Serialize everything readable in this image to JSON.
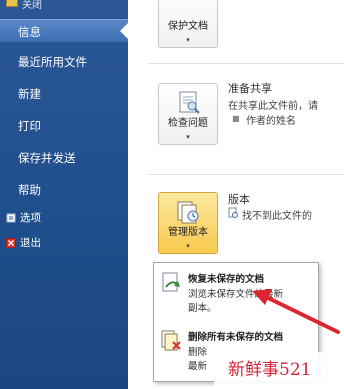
{
  "nav": {
    "partial_top": "关闭",
    "items": [
      {
        "label": "信息",
        "active": true
      },
      {
        "label": "最近所用文件"
      },
      {
        "label": "新建"
      },
      {
        "label": "打印"
      },
      {
        "label": "保存并发送"
      },
      {
        "label": "帮助"
      },
      {
        "label": "选项"
      },
      {
        "label": "退出"
      }
    ]
  },
  "protect": {
    "button_label": "保护文档",
    "arrow": "▾"
  },
  "prepare": {
    "title": "准备共享",
    "desc": "在共享此文件前，请",
    "bullet": "作者的姓名",
    "button_label": "检查问题",
    "arrow": "▾"
  },
  "versions": {
    "title": "版本",
    "desc": "找不到此文件的",
    "button_label": "管理版本",
    "arrow": "▾"
  },
  "dropdown": {
    "recover": {
      "title": "恢复未保存的文档",
      "line1": "浏览未保存文件的最新",
      "line2": "副本。"
    },
    "delete": {
      "title": "删除所有未保存的文档",
      "line1": "删除",
      "line2": "最新"
    }
  },
  "watermark": "新鲜事521",
  "colors": {
    "nav_bg": "#1f4e8c",
    "selected_btn": "#f7c94e",
    "arrow": "#e0242f",
    "watermark": "#d4263a"
  }
}
